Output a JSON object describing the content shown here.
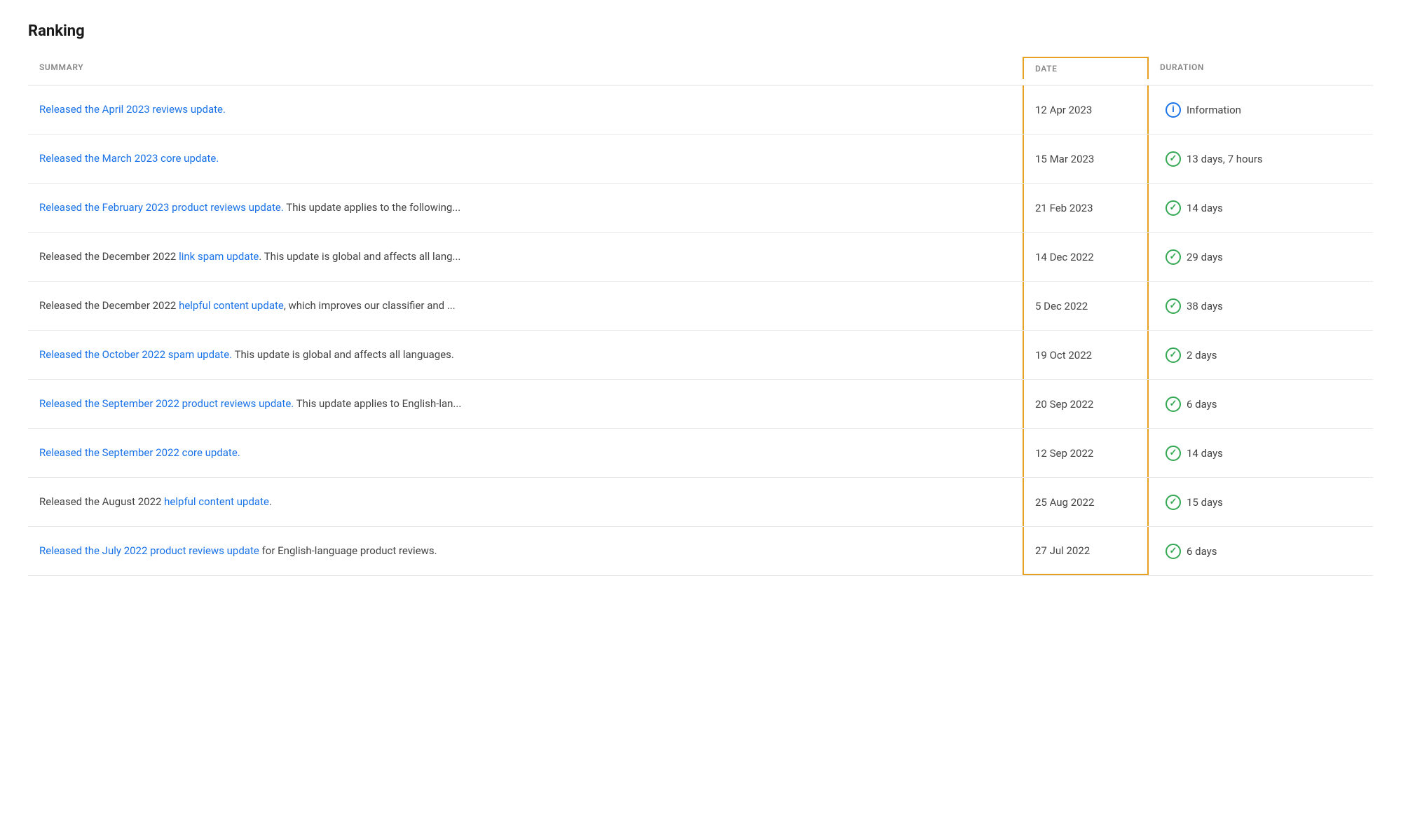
{
  "page": {
    "title": "Ranking"
  },
  "table": {
    "headers": {
      "summary": "SUMMARY",
      "date": "DATE",
      "duration": "DURATION"
    },
    "rows": [
      {
        "id": 1,
        "summary_parts": [
          {
            "text": "Released the April 2023 reviews update.",
            "type": "link"
          }
        ],
        "summary_plain": "",
        "date": "12 Apr 2023",
        "duration": "Information",
        "duration_icon": "info"
      },
      {
        "id": 2,
        "summary_parts": [
          {
            "text": "Released the March 2023 core update.",
            "type": "link"
          }
        ],
        "summary_plain": "",
        "date": "15 Mar 2023",
        "duration": "13 days, 7 hours",
        "duration_icon": "check"
      },
      {
        "id": 3,
        "summary_parts": [
          {
            "text": "Released the February 2023 product reviews update.",
            "type": "link"
          },
          {
            "text": " This update applies to the following...",
            "type": "text"
          }
        ],
        "date": "21 Feb 2023",
        "duration": "14 days",
        "duration_icon": "check"
      },
      {
        "id": 4,
        "summary_parts": [
          {
            "text": "Released",
            "type": "text"
          },
          {
            "text": " the December 2022 ",
            "type": "text"
          },
          {
            "text": "link spam update",
            "type": "link"
          },
          {
            "text": ". This update is global and affects all lang...",
            "type": "text"
          }
        ],
        "date": "14 Dec 2022",
        "duration": "29 days",
        "duration_icon": "check"
      },
      {
        "id": 5,
        "summary_parts": [
          {
            "text": "Released the December 2022 ",
            "type": "text"
          },
          {
            "text": "helpful content update",
            "type": "link"
          },
          {
            "text": ", which improves our classifier and ...",
            "type": "text"
          }
        ],
        "date": "5 Dec 2022",
        "duration": "38 days",
        "duration_icon": "check"
      },
      {
        "id": 6,
        "summary_parts": [
          {
            "text": "Released the October 2022 spam update.",
            "type": "link"
          },
          {
            "text": " This update is global and affects all languages.",
            "type": "text"
          }
        ],
        "date": "19 Oct 2022",
        "duration": "2 days",
        "duration_icon": "check"
      },
      {
        "id": 7,
        "summary_parts": [
          {
            "text": "Released the September 2022 product reviews update.",
            "type": "link"
          },
          {
            "text": " This update applies to English-lan...",
            "type": "text"
          }
        ],
        "date": "20 Sep 2022",
        "duration": "6 days",
        "duration_icon": "check"
      },
      {
        "id": 8,
        "summary_parts": [
          {
            "text": "Released the September 2022 core update.",
            "type": "link"
          }
        ],
        "date": "12 Sep 2022",
        "duration": "14 days",
        "duration_icon": "check"
      },
      {
        "id": 9,
        "summary_parts": [
          {
            "text": "Released",
            "type": "text"
          },
          {
            "text": " the August 2022 ",
            "type": "text"
          },
          {
            "text": "helpful content update",
            "type": "link"
          },
          {
            "text": ".",
            "type": "text"
          }
        ],
        "date": "25 Aug 2022",
        "duration": "15 days",
        "duration_icon": "check"
      },
      {
        "id": 10,
        "summary_parts": [
          {
            "text": "Released the July 2022 product reviews update",
            "type": "link"
          },
          {
            "text": " for English-language product reviews.",
            "type": "text"
          }
        ],
        "date": "27 Jul 2022",
        "duration": "6 days",
        "duration_icon": "check"
      }
    ]
  }
}
